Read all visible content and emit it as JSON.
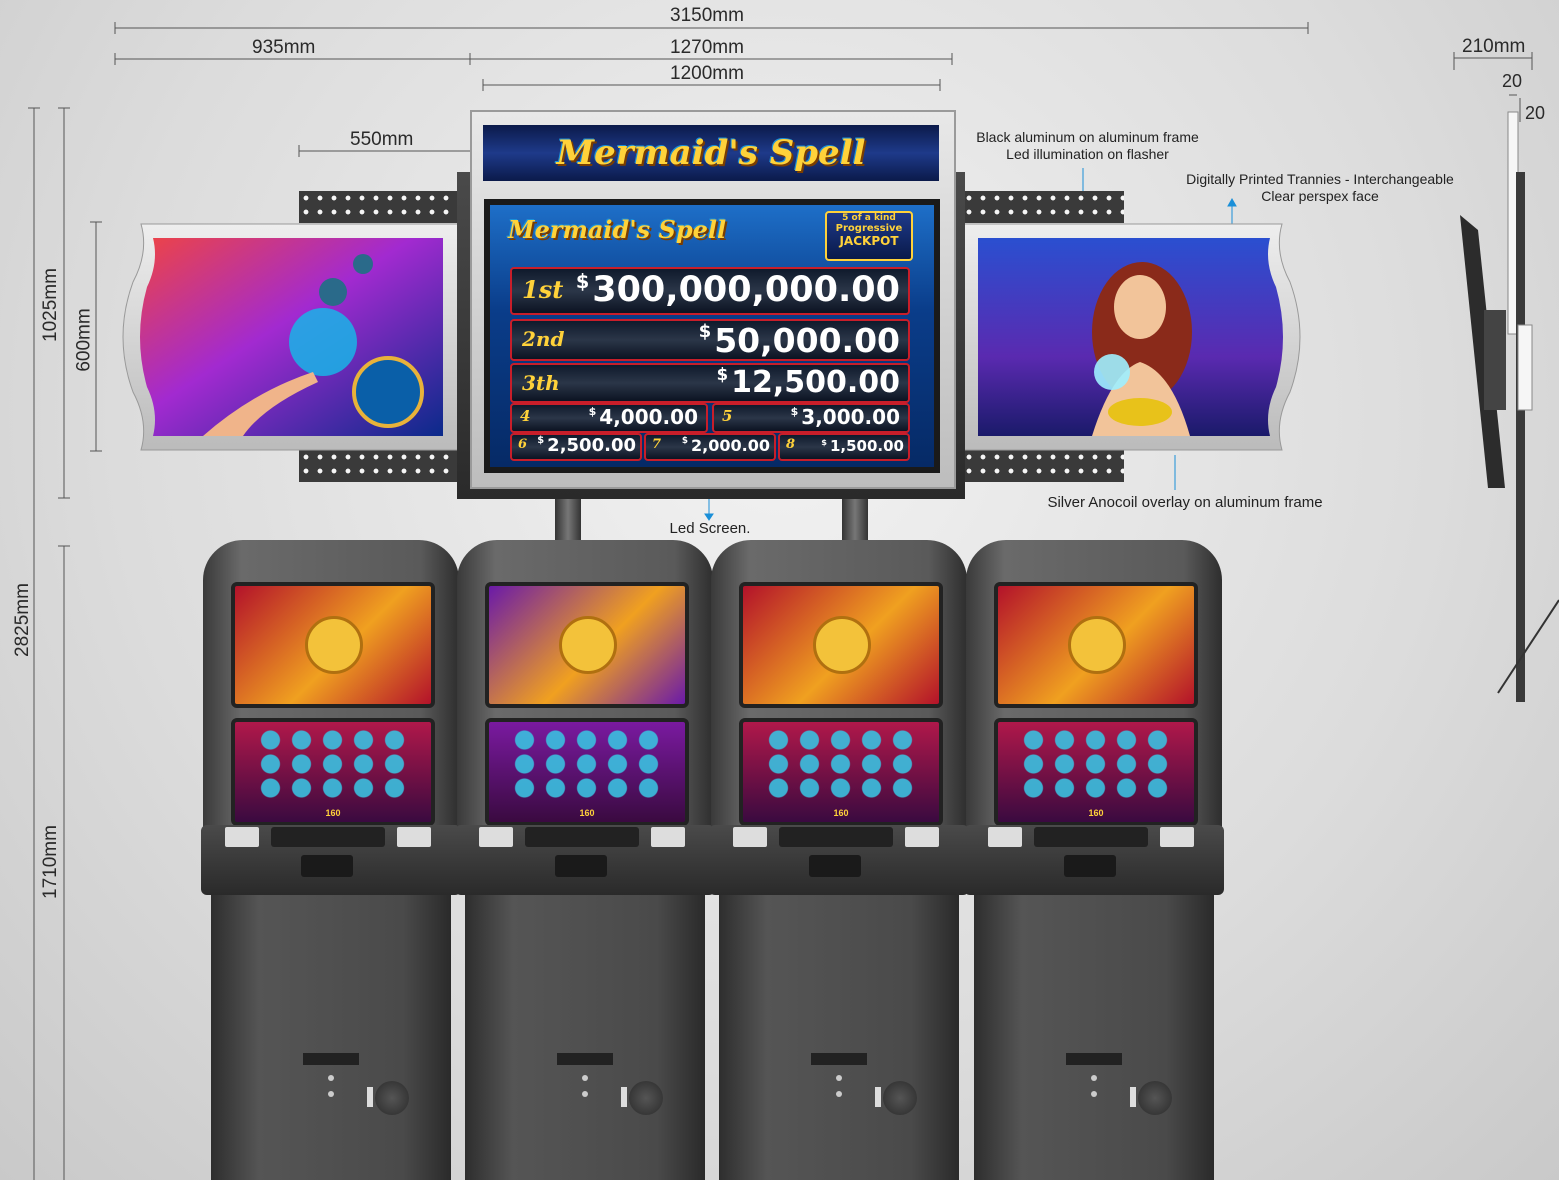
{
  "dimensions": {
    "overall_width": "3150mm",
    "wing_width": "935mm",
    "center_width": "1270mm",
    "screen_width": "1200mm",
    "flasher_width": "550mm",
    "side_depth": "210mm",
    "side_a": "20",
    "side_b": "20",
    "sign_height": "1025mm",
    "wing_height": "600mm",
    "total_height": "2825mm",
    "cabinet_height": "1710mm"
  },
  "annotations": {
    "frame_line1": "Black aluminum on aluminum frame",
    "frame_line2": "Led illumination on flasher",
    "tranny_line1": "Digitally Printed Trannies - Interchangeable",
    "tranny_line2": "Clear perspex face",
    "overlay": "Silver Anocoil overlay on aluminum frame",
    "led_screen": "Led Screen."
  },
  "sign": {
    "title": "Mermaid's Spell",
    "screen_title": "Mermaid's Spell",
    "badge": [
      "5 of a kind",
      "Progressive",
      "JACKPOT"
    ],
    "currency": "$",
    "jackpots": [
      {
        "label": "1st",
        "value": "300,000,000.00"
      },
      {
        "label": "2nd",
        "value": "50,000.00"
      },
      {
        "label": "3th",
        "value": "12,500.00"
      },
      {
        "label": "4",
        "value": "4,000.00"
      },
      {
        "label": "5",
        "value": "3,000.00"
      },
      {
        "label": "6",
        "value": "2,500.00"
      },
      {
        "label": "7",
        "value": "2,000.00"
      },
      {
        "label": "8",
        "value": "1,500.00"
      }
    ]
  },
  "cabinets": [
    {
      "top_screen_color": "#b3122a",
      "reel_color": "#b0184a",
      "bet": "160"
    },
    {
      "top_screen_color": "#6a1aa8",
      "reel_color": "#7a1aa0",
      "bet": "160"
    },
    {
      "top_screen_color": "#b3122a",
      "reel_color": "#b0184a",
      "bet": "160"
    },
    {
      "top_screen_color": "#b3122a",
      "reel_color": "#b0184a",
      "bet": "160"
    }
  ],
  "colors": {
    "dimension_line": "#555555",
    "frame_dark": "#3a3a3a",
    "accent_red": "#c81e2a",
    "gold": "#ffd23a",
    "callout_blue": "#1a8fd8"
  }
}
